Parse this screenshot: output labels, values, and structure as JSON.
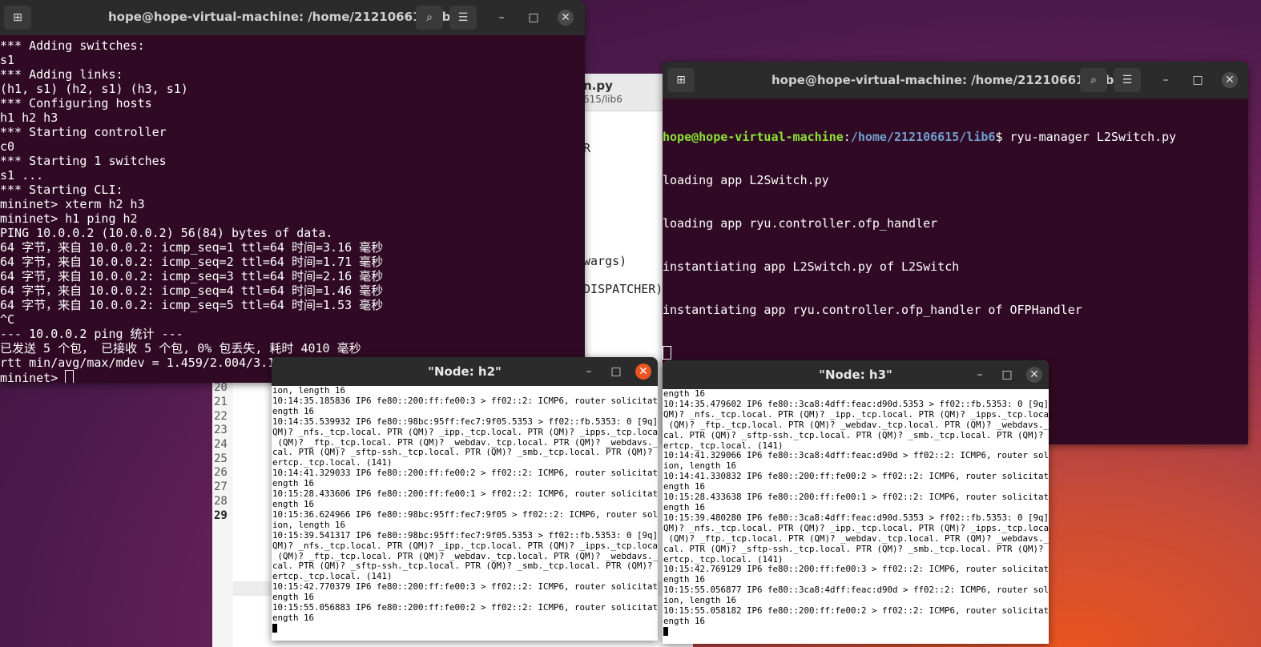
{
  "editor": {
    "title": "n.py",
    "subtitle": "615/lib6",
    "code_fragments": [
      "R",
      "wargs)",
      "DISPATCHER)"
    ],
    "line_numbers": [
      "20",
      "21",
      "22",
      "23",
      "24",
      "25",
      "26",
      "27",
      "28",
      "29"
    ]
  },
  "mininet_terminal": {
    "title": "hope@hope-virtual-machine: /home/212106615/lib6",
    "lines": [
      "*** Adding switches:",
      "s1",
      "*** Adding links:",
      "(h1, s1) (h2, s1) (h3, s1)",
      "*** Configuring hosts",
      "h1 h2 h3",
      "*** Starting controller",
      "c0",
      "*** Starting 1 switches",
      "s1 ...",
      "*** Starting CLI:",
      "mininet> xterm h2 h3",
      "mininet> h1 ping h2",
      "PING 10.0.0.2 (10.0.0.2) 56(84) bytes of data.",
      "64 字节，来自 10.0.0.2: icmp_seq=1 ttl=64 时间=3.16 毫秒",
      "64 字节，来自 10.0.0.2: icmp_seq=2 ttl=64 时间=1.71 毫秒",
      "64 字节，来自 10.0.0.2: icmp_seq=3 ttl=64 时间=2.16 毫秒",
      "64 字节，来自 10.0.0.2: icmp_seq=4 ttl=64 时间=1.46 毫秒",
      "64 字节，来自 10.0.0.2: icmp_seq=5 ttl=64 时间=1.53 毫秒",
      "^C",
      "--- 10.0.0.2 ping 统计 ---",
      "已发送 5 个包， 已接收 5 个包, 0% 包丢失, 耗时 4010 毫秒",
      "rtt min/avg/max/mdev = 1.459/2.004/3.1"
    ],
    "prompt": "mininet> "
  },
  "ryu_terminal": {
    "title": "hope@hope-virtual-machine: /home/212106615/lib6",
    "prompt_user": "hope@hope-virtual-machine",
    "prompt_sep": ":",
    "prompt_path": "/home/212106615/lib6",
    "prompt_cmd": "$ ryu-manager L2Switch.py",
    "lines": [
      "loading app L2Switch.py",
      "loading app ryu.controller.ofp_handler",
      "instantiating app L2Switch.py of L2Switch",
      "instantiating app ryu.controller.ofp_handler of OFPHandler"
    ]
  },
  "xterm_h2": {
    "title": "\"Node: h2\"",
    "lines": [
      "ion, length 16",
      "10:14:35.185836 IP6 fe80::200:ff:fe00:3 > ff02::2: ICMP6, router solicitation, l",
      "ength 16",
      "10:14:35.539932 IP6 fe80::98bc:95ff:fec7:9f05.5353 > ff02::fb.5353: 0 [9q] PTR (",
      "QM)? _nfs._tcp.local. PTR (QM)? _ipp._tcp.local. PTR (QM)? _ipps._tcp.local. PTR",
      " (QM)? _ftp._tcp.local. PTR (QM)? _webdav._tcp.local. PTR (QM)? _webdavs._tcp.lo",
      "cal. PTR (QM)? _sftp-ssh._tcp.local. PTR (QM)? _smb._tcp.local. PTR (QM)? _afpov",
      "ertcp._tcp.local. (141)",
      "10:14:41.329033 IP6 fe80::200:ff:fe00:2 > ff02::2: ICMP6, router solicitation, l",
      "ength 16",
      "10:15:28.433606 IP6 fe80::200:ff:fe00:1 > ff02::2: ICMP6, router solicitation, l",
      "ength 16",
      "10:15:36.624966 IP6 fe80::98bc:95ff:fec7:9f05 > ff02::2: ICMP6, router solicitat",
      "ion, length 16",
      "10:15:39.541317 IP6 fe80::98bc:95ff:fec7:9f05.5353 > ff02::fb.5353: 0 [9q] PTR (",
      "QM)? _nfs._tcp.local. PTR (QM)? _ipp._tcp.local. PTR (QM)? _ipps._tcp.local. PTR",
      " (QM)? _ftp._tcp.local. PTR (QM)? _webdav._tcp.local. PTR (QM)? _webdavs._tcp.lo",
      "cal. PTR (QM)? _sftp-ssh._tcp.local. PTR (QM)? _smb._tcp.local. PTR (QM)? _afpov",
      "ertcp._tcp.local. (141)",
      "10:15:42.770379 IP6 fe80::200:ff:fe00:3 > ff02::2: ICMP6, router solicitation, l",
      "ength 16",
      "10:15:55.056883 IP6 fe80::200:ff:fe00:2 > ff02::2: ICMP6, router solicitation, l",
      "ength 16"
    ]
  },
  "xterm_h3": {
    "title": "\"Node: h3\"",
    "lines": [
      "ength 16",
      "10:14:35.479602 IP6 fe80::3ca8:4dff:feac:d90d.5353 > ff02::fb.5353: 0 [9q] PTR (",
      "QM)? _nfs._tcp.local. PTR (QM)? _ipp._tcp.local. PTR (QM)? _ipps._tcp.local. PTR",
      " (QM)? _ftp._tcp.local. PTR (QM)? _webdav._tcp.local. PTR (QM)? _webdavs._tcp.lo",
      "cal. PTR (QM)? _sftp-ssh._tcp.local. PTR (QM)? _smb._tcp.local. PTR (QM)? _afpov",
      "ertcp._tcp.local. (141)",
      "10:14:41.329066 IP6 fe80::3ca8:4dff:feac:d90d > ff02::2: ICMP6, router solicitat",
      "ion, length 16",
      "10:14:41.330832 IP6 fe80::200:ff:fe00:2 > ff02::2: ICMP6, router solicitation, l",
      "ength 16",
      "10:15:28.433638 IP6 fe80::200:ff:fe00:1 > ff02::2: ICMP6, router solicitation, l",
      "ength 16",
      "10:15:39.480280 IP6 fe80::3ca8:4dff:feac:d90d.5353 > ff02::fb.5353: 0 [9q] PTR (",
      "QM)? _nfs._tcp.local. PTR (QM)? _ipp._tcp.local. PTR (QM)? _ipps._tcp.local. PTR",
      " (QM)? _ftp._tcp.local. PTR (QM)? _webdav._tcp.local. PTR (QM)? _webdavs._tcp.lo",
      "cal. PTR (QM)? _sftp-ssh._tcp.local. PTR (QM)? _smb._tcp.local. PTR (QM)? _afpov",
      "ertcp._tcp.local. (141)",
      "10:15:42.769129 IP6 fe80::200:ff:fe00:3 > ff02::2: ICMP6, router solicitation, l",
      "ength 16",
      "10:15:55.056877 IP6 fe80::3ca8:4dff:feac:d90d > ff02::2: ICMP6, router solicitat",
      "ion, length 16",
      "10:15:55.058182 IP6 fe80::200:ff:fe00:2 > ff02::2: ICMP6, router solicitation, l",
      "ength 16"
    ]
  },
  "colors": {
    "terminal_bg": "#300a24",
    "prompt_user": "#8ae234",
    "prompt_path": "#729fcf",
    "close_active": "#e95420"
  }
}
